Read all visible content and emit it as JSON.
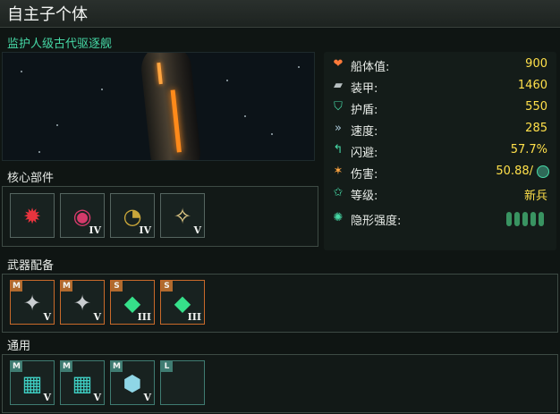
{
  "title": "自主子个体",
  "subtitle": "监护人级古代驱逐舰",
  "stats": [
    {
      "icon": "heart-icon",
      "label": "船体值:",
      "value": "900"
    },
    {
      "icon": "armor-plate-icon",
      "label": "装甲:",
      "value": "1460"
    },
    {
      "icon": "shield-icon",
      "label": "护盾:",
      "value": "550"
    },
    {
      "icon": "speed-arrows-icon",
      "label": "速度:",
      "value": "285"
    },
    {
      "icon": "evade-arrow-icon",
      "label": "闪避:",
      "value": "57.7%"
    },
    {
      "icon": "damage-burst-icon",
      "label": "伤害:",
      "value": "50.88/"
    },
    {
      "icon": "rank-star-icon",
      "label": "等级:",
      "value": "新兵"
    },
    {
      "icon": "cloak-icon",
      "label": "隐形强度:",
      "value": ""
    }
  ],
  "sections": {
    "core": "核心部件",
    "weapons": "武器配备",
    "utility": "通用"
  },
  "core_slots": [
    {
      "icon": "red-reactor-icon",
      "tier": ""
    },
    {
      "icon": "thruster-icon",
      "tier": "IV"
    },
    {
      "icon": "sensor-radar-icon",
      "tier": "IV"
    },
    {
      "icon": "ftl-drive-icon",
      "tier": "V"
    }
  ],
  "weapon_slots": [
    {
      "size": "M",
      "icon": "autocannon-icon",
      "tier": "V"
    },
    {
      "size": "M",
      "icon": "autocannon-icon",
      "tier": "V"
    },
    {
      "size": "S",
      "icon": "energy-crystal-icon",
      "tier": "III"
    },
    {
      "size": "S",
      "icon": "energy-crystal-icon",
      "tier": "III"
    }
  ],
  "utility_slots": [
    {
      "size": "M",
      "icon": "armor-block-icon",
      "tier": "V"
    },
    {
      "size": "M",
      "icon": "armor-block-icon",
      "tier": "V"
    },
    {
      "size": "M",
      "icon": "hex-shield-icon",
      "tier": "V"
    },
    {
      "size": "L",
      "icon": "",
      "tier": ""
    }
  ],
  "colors": {
    "accent": "#46d9a6",
    "value": "#ffe04a",
    "weapon_border": "#c96a2a",
    "utility_border": "#3f7c72"
  }
}
